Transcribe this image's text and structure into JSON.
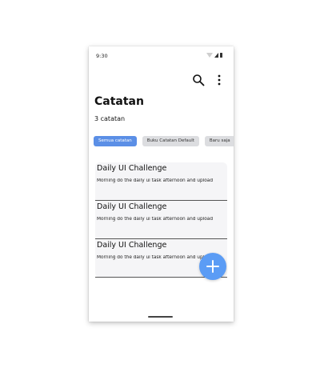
{
  "status_bar": {
    "time": "9:30"
  },
  "header": {
    "title": "Catatan",
    "subtitle": "3 catatan",
    "search_icon": "search-icon",
    "more_icon": "more-vertical-icon"
  },
  "filters": [
    {
      "label": "Semua catatan",
      "active": true
    },
    {
      "label": "Buku Catatan Default",
      "active": false
    },
    {
      "label": "Baru saja",
      "active": false
    }
  ],
  "notes": [
    {
      "title": "Daily UI Challenge",
      "body": "Morning do the daily ui task afternoon and upload"
    },
    {
      "title": "Daily UI Challenge",
      "body": "Morning do the daily ui task afternoon and upload"
    },
    {
      "title": "Daily UI Challenge",
      "body": "Morning do the daily ui task afternoon and upload"
    }
  ],
  "fab": {
    "icon": "plus-icon"
  },
  "colors": {
    "accent": "#5b8fe6",
    "fab": "#5b9cf5",
    "chip": "#dcdde0",
    "card": "#f5f5f7"
  }
}
